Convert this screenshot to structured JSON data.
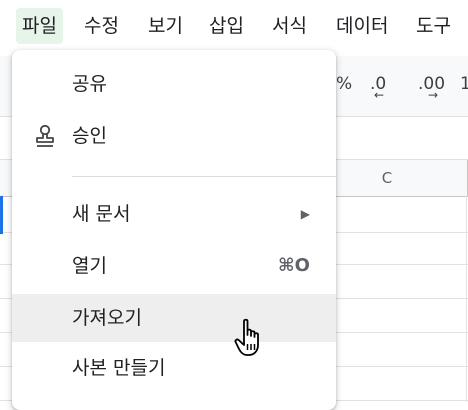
{
  "menubar": {
    "items": [
      "파일",
      "수정",
      "보기",
      "삽입",
      "서식",
      "데이터",
      "도구"
    ],
    "active_color": "#e6f4ea"
  },
  "toolbar": {
    "percent": "%",
    "decimal_decrease": ".0",
    "decimal_increase": ".00",
    "font_size_fragment": "1"
  },
  "sheet": {
    "column_c": "C",
    "selection_color": "#1a73e8"
  },
  "file_menu": {
    "items": [
      {
        "label": "공유"
      },
      {
        "label": "승인",
        "icon": "stamp-icon"
      },
      {
        "label": "새 문서",
        "submenu": true
      },
      {
        "label": "열기",
        "shortcut": "⌘O"
      },
      {
        "label": "가져오기",
        "hovered": true
      },
      {
        "label": "사본 만들기"
      }
    ],
    "hover_color": "#eeeeee"
  },
  "cursor": "hand-pointer-icon"
}
